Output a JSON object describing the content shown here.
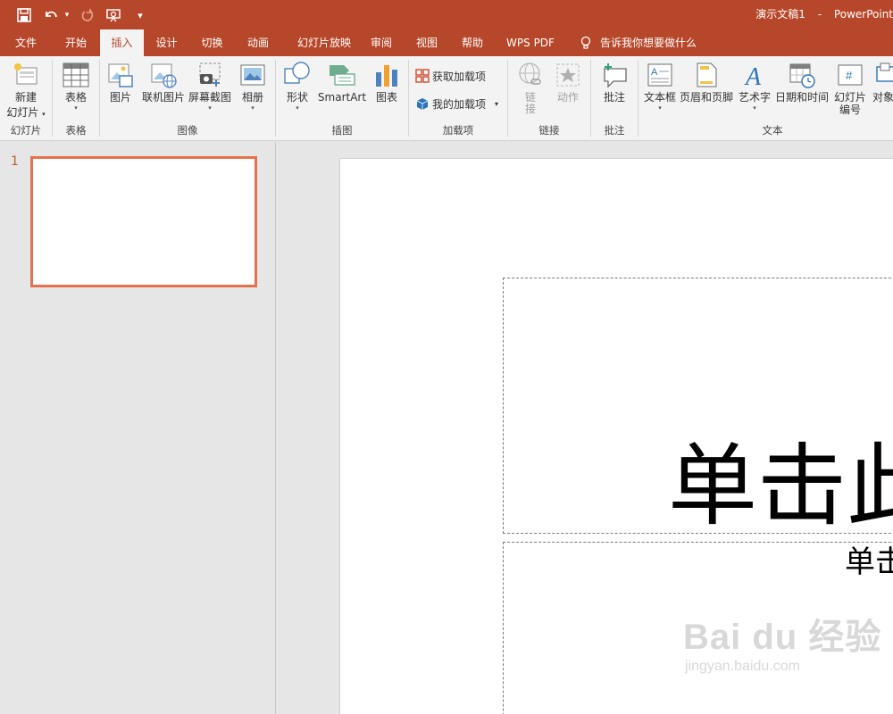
{
  "title": {
    "document": "演示文稿1",
    "separator": "-",
    "app": "PowerPoint"
  },
  "qat": {
    "save": "save-icon",
    "undo": "undo-icon",
    "redo": "redo-icon",
    "present": "present-icon",
    "customize": "customize-icon"
  },
  "tabs": [
    "文件",
    "开始",
    "插入",
    "设计",
    "切换",
    "动画",
    "幻灯片放映",
    "审阅",
    "视图",
    "帮助",
    "WPS PDF"
  ],
  "active_tab": "插入",
  "tell_me": "告诉我你想要做什么",
  "ribbon": {
    "slides": {
      "label": "幻灯片",
      "new_slide_line1": "新建",
      "new_slide_line2": "幻灯片"
    },
    "tables": {
      "label": "表格",
      "table": "表格"
    },
    "images": {
      "label": "图像",
      "picture": "图片",
      "online_picture": "联机图片",
      "screenshot": "屏幕截图",
      "album": "相册"
    },
    "illustrations": {
      "label": "插图",
      "shapes": "形状",
      "smartart": "SmartArt",
      "chart": "图表"
    },
    "addins": {
      "label": "加载项",
      "get": "获取加载项",
      "mine": "我的加载项"
    },
    "links": {
      "label": "链接",
      "link_line1": "链",
      "link_line2": "接",
      "action": "动作"
    },
    "comments": {
      "label": "批注",
      "comment": "批注"
    },
    "text": {
      "label": "文本",
      "textbox": "文本框",
      "header_footer": "页眉和页脚",
      "wordart": "艺术字",
      "datetime": "日期和时间",
      "slide_number_line1": "幻灯片",
      "slide_number_line2": "编号",
      "object": "对象"
    }
  },
  "slides_panel": {
    "number": "1"
  },
  "slide": {
    "title_placeholder": "单击此处添加标题",
    "subtitle_placeholder": "单击此处添加副标题"
  },
  "watermark": {
    "main": "Bai du 经验",
    "sub": "jingyan.baidu.com"
  },
  "colors": {
    "accent": "#b7472a",
    "thumb_border": "#e8704a",
    "ribbon_bg": "#f3f3f3",
    "workspace": "#e6e6e6"
  }
}
